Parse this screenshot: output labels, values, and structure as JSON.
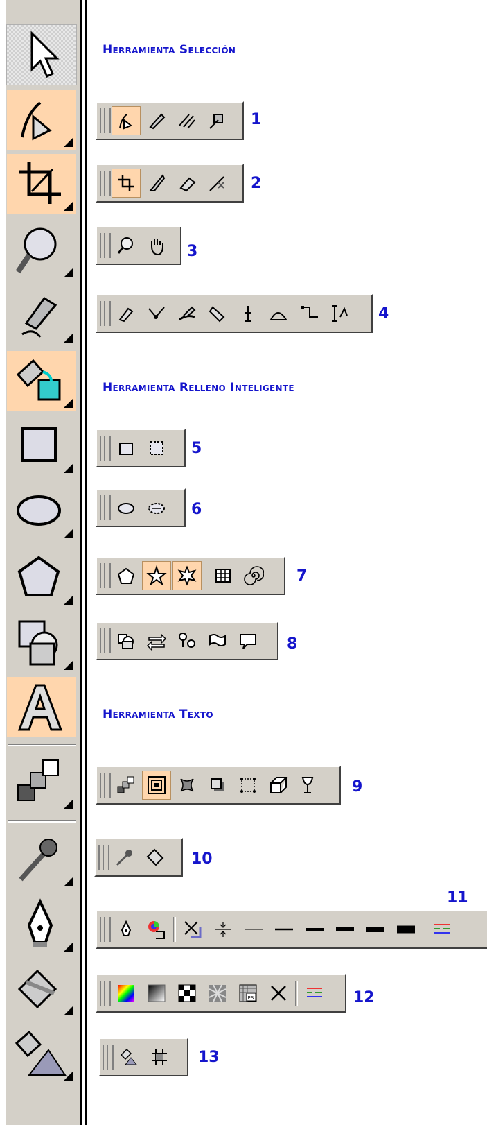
{
  "headings": {
    "seleccion": "Herramienta Selección",
    "relleno": "Herramienta Relleno Inteligente",
    "texto": "Herramienta Texto"
  },
  "numbers": [
    "1",
    "2",
    "3",
    "4",
    "5",
    "6",
    "7",
    "8",
    "9",
    "10",
    "11",
    "12",
    "13"
  ],
  "colors": {
    "accent_blue": "#1515cc",
    "active": "#ffd6ad",
    "panel": "#d4d0c8"
  },
  "toolbox_icons": [
    "pick-tool-icon",
    "shape-tool-icon",
    "crop-tool-icon",
    "zoom-tool-icon",
    "freehand-tool-icon",
    "smart-fill-tool-icon",
    "rectangle-tool-icon",
    "ellipse-tool-icon",
    "polygon-tool-icon",
    "basic-shapes-tool-icon",
    "text-tool-icon",
    "interactive-blend-tool-icon",
    "eyedropper-tool-icon",
    "outline-tool-icon",
    "fill-tool-icon",
    "interactive-fill-tool-icon"
  ]
}
